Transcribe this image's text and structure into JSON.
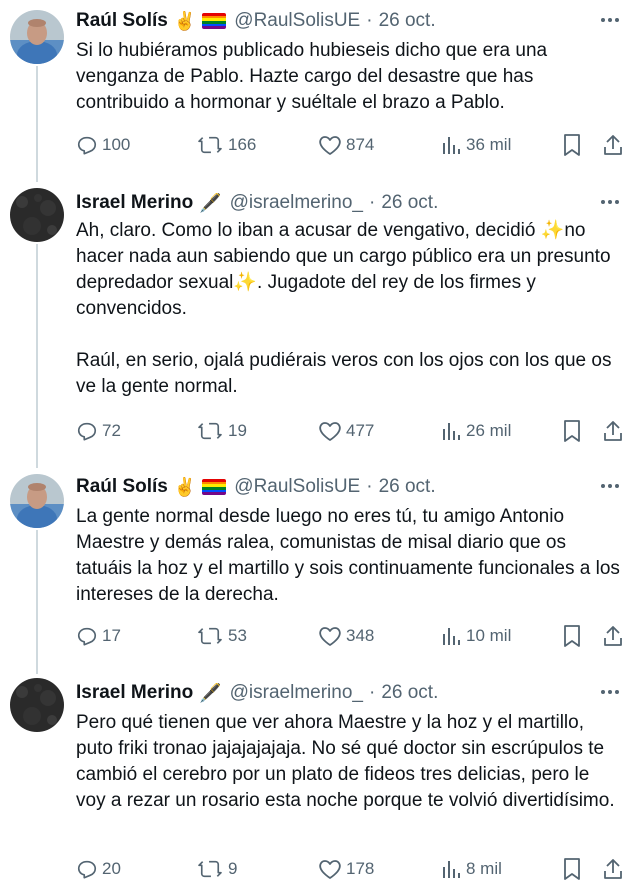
{
  "tweets": [
    {
      "name": "Raúl Solís",
      "badges": [
        "✌️",
        "rainbow-flag"
      ],
      "handle": "@RaulSolisUE",
      "separator": "·",
      "date": "26 oct.",
      "text": "Si lo hubiéramos publicado hubieseis dicho que era una venganza de Pablo. Hazte cargo del desastre que has contribuido a hormonar y suéltale el brazo a Pablo.",
      "replies": "100",
      "retweets": "166",
      "likes": "874",
      "views": "36 mil",
      "avatar": "bald-man-avatar"
    },
    {
      "name": "Israel Merino",
      "badges": [
        "🖋️"
      ],
      "handle": "@israelmerino_",
      "separator": "·",
      "date": "26 oct.",
      "text": "Ah, claro. Como lo iban a acusar de vengativo, decidió ✨no hacer nada aun sabiendo que un cargo público era un presunto depredador sexual✨. Jugadote del rey de los firmes y convencidos.\n\nRaúl, en serio, ojalá pudiérais veros con los ojos con los que os ve la gente normal.",
      "replies": "72",
      "retweets": "19",
      "likes": "477",
      "views": "26 mil",
      "avatar": "dark-textured-avatar"
    },
    {
      "name": "Raúl Solís",
      "badges": [
        "✌️",
        "rainbow-flag"
      ],
      "handle": "@RaulSolisUE",
      "separator": "·",
      "date": "26 oct.",
      "text": "La gente normal desde luego no eres tú, tu amigo Antonio Maestre y demás ralea, comunistas de misal diario que os tatuáis la hoz y el martillo y sois continuamente funcionales a los intereses de la derecha.",
      "replies": "17",
      "retweets": "53",
      "likes": "348",
      "views": "10 mil",
      "avatar": "bald-man-avatar"
    },
    {
      "name": "Israel Merino",
      "badges": [
        "🖋️"
      ],
      "handle": "@israelmerino_",
      "separator": "·",
      "date": "26 oct.",
      "text": "Pero qué tienen que ver ahora Maestre y la hoz y el martillo, puto friki tronao jajajajajaja. No sé qué doctor sin escrúpulos te cambió el cerebro por un plato de fideos tres delicias, pero le voy a rezar un rosario esta noche porque te volvió divertidísimo.",
      "replies": "20",
      "retweets": "9",
      "likes": "178",
      "views": "8 mil",
      "avatar": "dark-textured-avatar"
    }
  ],
  "colors": {
    "text": "#0f1419",
    "secondary": "#536471",
    "thread_line": "#cfd9de"
  }
}
